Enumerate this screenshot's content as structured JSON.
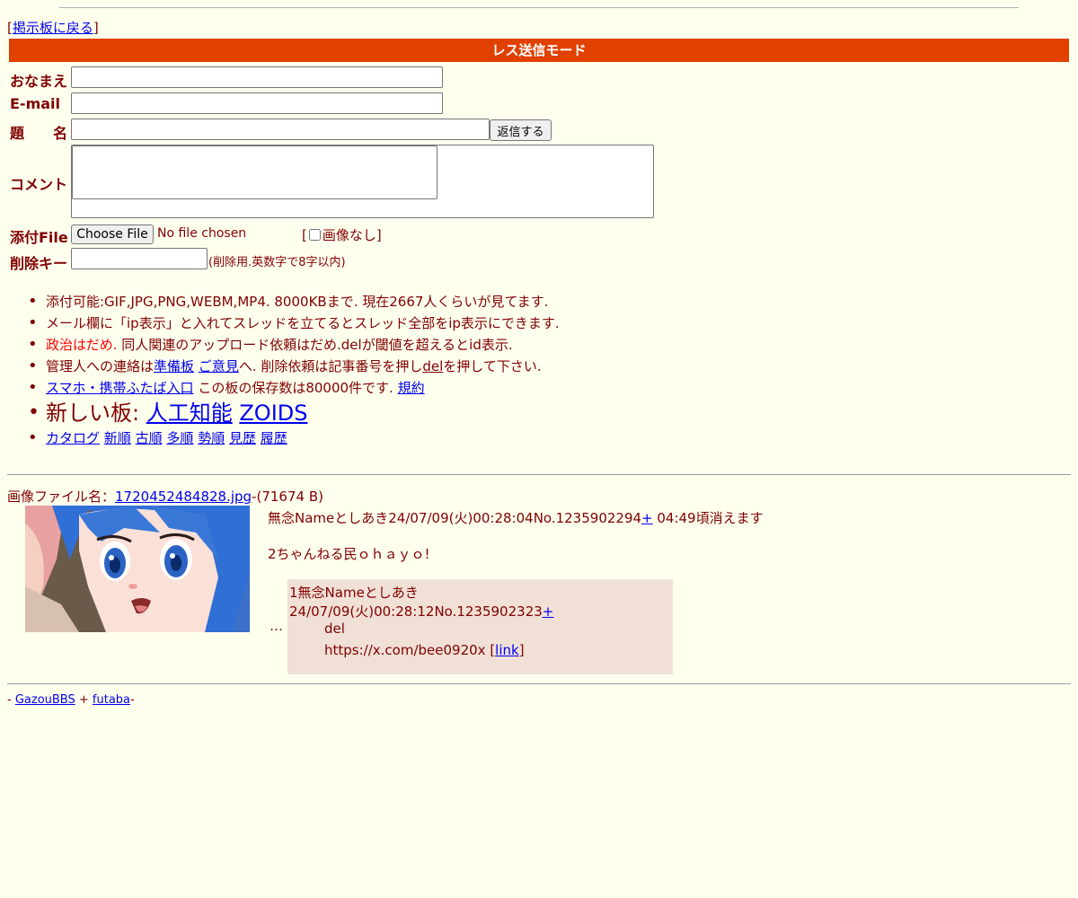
{
  "nav": {
    "back_open": "[",
    "back_link": "掲示板に戻る",
    "back_close": "]"
  },
  "form": {
    "mode_title": "レス送信モード",
    "name_label": "おなまえ",
    "email_label": "E-mail",
    "subject_label": "題　　名",
    "submit_label": "返信する",
    "comment_label": "コメント",
    "file_label": "添付File",
    "choose_file_label": "Choose File",
    "no_file_text": "No file chosen",
    "noimg_open": "[",
    "noimg_label": "画像なし",
    "noimg_close": "]",
    "delkey_label": "削除キー",
    "delkey_hint": "(削除用.英数字で8字以内)"
  },
  "info": {
    "line1": "添付可能:GIF,JPG,PNG,WEBM,MP4. 8000KBまで. 現在2667人くらいが見てます.",
    "line2": "メール欄に「ip表示」と入れてスレッドを立てるとスレッド全部をip表示にできます.",
    "line3_red": "政治はだめ.",
    "line3_rest": " 同人関連のアップロード依頼はだめ.delが閾値を超えるとid表示.",
    "line4_a": "管理人への連絡は",
    "line4_link1": "準備板",
    "line4_link2": "ご意見",
    "line4_b": "へ. 削除依頼は記事番号を押し",
    "line4_del": "del",
    "line4_c": "を押して下さい.",
    "line5_link": "スマホ・携帯ふたば入口",
    "line5_a": " この板の保存数は80000件です. ",
    "line5_link2": "規約",
    "line6_a": "新しい板: ",
    "line6_link1": "人工知能",
    "line6_link2": "ZOIDS",
    "sort_links": [
      "カタログ",
      "新順",
      "古順",
      "多順",
      "勢順",
      "見歴",
      "履歴"
    ]
  },
  "thread": {
    "file_prefix": "画像ファイル名：",
    "file_name": "1720452484828.jpg",
    "file_size": "-(71674 B)",
    "header": "無念Nameとしあき24/07/09(火)00:28:04No.1235902294",
    "plus": "+",
    "expire": " 04:49頃消えます",
    "body": "2ちゃんねる民ｏｈａｙｏ!",
    "ellipsis": "…"
  },
  "reply": {
    "header": "1無念Nameとしあき24/07/09(火)00:28:12No.1235902323",
    "plus": "+",
    "line1": "del",
    "line2": "https://x.com/bee0920x ",
    "link_open": "[",
    "link_label": "link",
    "link_close": "]"
  },
  "footer": {
    "prefix": "- ",
    "link1": "GazouBBS",
    "mid": " + ",
    "link2": "futaba",
    "suffix": "-"
  }
}
